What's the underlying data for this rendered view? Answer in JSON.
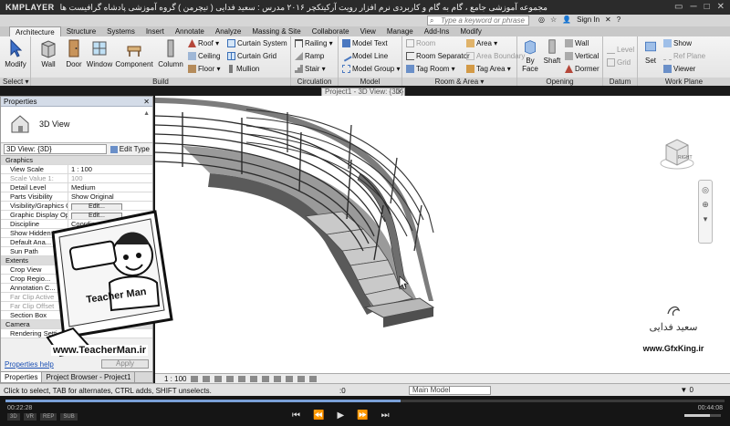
{
  "player": {
    "logo": "KMPLAYER",
    "title": "مجموعه آموزشی جامع ، گام به گام و کاربردی نرم افزار رویت آرکیتکچر ۲۰۱۶   مدرس : سعید فدایی ( تیچرمن ) گروه آموزشی پادشاه گرافیست ها",
    "controls": [
      "▭",
      "─",
      "□",
      "✕"
    ],
    "time_elapsed": "00:22:28",
    "time_total": "00:44:08",
    "buttons": [
      "⏮",
      "⏪",
      "▶",
      "⏩",
      "⏭"
    ],
    "badges": [
      "3D",
      "VR",
      "REP",
      "SUB"
    ]
  },
  "app": {
    "search_placeholder": "Type a keyword or phrase",
    "sign_in": "Sign In",
    "help": "?"
  },
  "tabs": [
    "Architecture",
    "Structure",
    "Systems",
    "Insert",
    "Annotate",
    "Analyze",
    "Massing & Site",
    "Collaborate",
    "View",
    "Manage",
    "Add-Ins",
    "Modify"
  ],
  "ribbon": {
    "select": {
      "modify": "Modify",
      "label": "Select ▾"
    },
    "build": {
      "label": "Build",
      "big": [
        "Wall",
        "Door",
        "Window",
        "Component",
        "Column"
      ],
      "small": [
        "Roof ▾",
        "Ceiling",
        "Floor ▾",
        "Curtain System",
        "Curtain Grid",
        "Mullion"
      ]
    },
    "circulation": {
      "label": "Circulation",
      "items": [
        "Railing ▾",
        "Ramp",
        "Stair ▾"
      ]
    },
    "model": {
      "label": "Model",
      "items": [
        "Model Text",
        "Model Line",
        "Model Group ▾"
      ]
    },
    "room": {
      "label": "Room & Area ▾",
      "items": [
        "Room",
        "Room Separator",
        "Tag Room ▾",
        "Area ▾",
        "Area Boundary",
        "Tag Area ▾"
      ]
    },
    "opening": {
      "label": "Opening",
      "items": [
        "By Face",
        "Shaft",
        "Wall",
        "Vertical",
        "Dormer"
      ]
    },
    "datum": {
      "label": "Datum",
      "items": [
        "Level",
        "Grid"
      ]
    },
    "workplane": {
      "label": "Work Plane",
      "items": [
        "Set",
        "Show",
        "Ref Plane",
        "Viewer"
      ]
    }
  },
  "properties": {
    "title": "Properties",
    "type_name": "3D View",
    "view_select": "3D View: {3D}",
    "edit_type": "Edit Type",
    "rows": [
      {
        "k": "Graphics",
        "v": "",
        "kind": "section"
      },
      {
        "k": "View Scale",
        "v": "1 : 100"
      },
      {
        "k": "Scale Value    1:",
        "v": "100",
        "kind": "grey"
      },
      {
        "k": "Detail Level",
        "v": "Medium"
      },
      {
        "k": "Parts Visibility",
        "v": "Show Original"
      },
      {
        "k": "Visibility/Graphics O...",
        "v": "Edit...",
        "kind": "button"
      },
      {
        "k": "Graphic Display Opti...",
        "v": "Edit...",
        "kind": "button"
      },
      {
        "k": "Discipline",
        "v": "Coordination"
      },
      {
        "k": "Show Hidden Lines",
        "v": "By Discipline"
      },
      {
        "k": "Default Ana...",
        "v": ""
      },
      {
        "k": "Sun Path",
        "v": ""
      },
      {
        "k": "Extents",
        "v": "",
        "kind": "section"
      },
      {
        "k": "Crop View",
        "v": ""
      },
      {
        "k": "Crop Regio...",
        "v": ""
      },
      {
        "k": "Annotation C...",
        "v": ""
      },
      {
        "k": "Far Clip Active",
        "v": "",
        "kind": "grey"
      },
      {
        "k": "Far Clip Offset",
        "v": "",
        "kind": "grey"
      },
      {
        "k": "Section Box",
        "v": ""
      },
      {
        "k": "Camera",
        "v": "",
        "kind": "section"
      },
      {
        "k": "Rendering Setti...",
        "v": ""
      }
    ],
    "help": "Properties help",
    "apply": "Apply",
    "tabs": [
      "Properties",
      "Project Browser - Project1"
    ]
  },
  "viewport": {
    "tab": "Project1 - 3D View: {3D}",
    "cube_label": "RIGHT",
    "scale": "1 : 100"
  },
  "watermark": {
    "teacher_brand": "Teacher Man",
    "teacher_site": "www.TeacherMan.ir",
    "signature": "سعید فدایی",
    "gfx_site": "www.GfxKing.ir"
  },
  "status": {
    "message": "Click to select, TAB for alternates, CTRL adds, SHIFT unselects.",
    "zero": ":0",
    "model": "Main Model"
  }
}
